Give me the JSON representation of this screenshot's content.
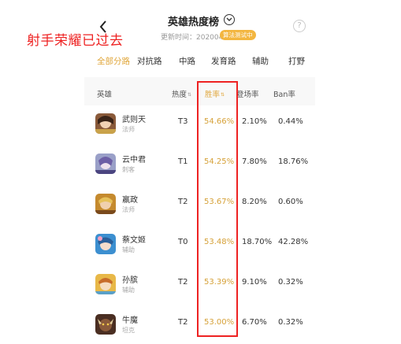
{
  "header": {
    "title": "英雄热度榜",
    "update_time": "更新时间：20200416",
    "badge": "算法测试中",
    "help_glyph": "?"
  },
  "annotation": {
    "overlay_text": "射手荣耀已过去",
    "color": "#ee2222"
  },
  "tabs": [
    {
      "label": "全部分路",
      "active": true
    },
    {
      "label": "对抗路",
      "active": false
    },
    {
      "label": "中路",
      "active": false
    },
    {
      "label": "发育路",
      "active": false
    },
    {
      "label": "辅助",
      "active": false
    },
    {
      "label": "打野",
      "active": false
    }
  ],
  "table": {
    "columns": [
      {
        "label": "英雄"
      },
      {
        "label": "热度",
        "sort_icon": "⇅"
      },
      {
        "label": "胜率",
        "sort_icon": "⇅"
      },
      {
        "label": "登场率"
      },
      {
        "label": "Ban率"
      }
    ],
    "rows": [
      {
        "name": "武则天",
        "role": "法师",
        "heat": "T3",
        "win": "54.66%",
        "appear": "2.10%",
        "ban": "0.44%"
      },
      {
        "name": "云中君",
        "role": "刺客",
        "heat": "T1",
        "win": "54.25%",
        "appear": "7.80%",
        "ban": "18.76%"
      },
      {
        "name": "嬴政",
        "role": "法师",
        "heat": "T2",
        "win": "53.67%",
        "appear": "8.20%",
        "ban": "0.60%"
      },
      {
        "name": "蔡文姬",
        "role": "辅助",
        "heat": "T0",
        "win": "53.48%",
        "appear": "18.70%",
        "ban": "42.28%"
      },
      {
        "name": "孙膑",
        "role": "辅助",
        "heat": "T2",
        "win": "53.39%",
        "appear": "9.10%",
        "ban": "0.32%"
      },
      {
        "name": "牛魔",
        "role": "坦克",
        "heat": "T2",
        "win": "53.00%",
        "appear": "6.70%",
        "ban": "0.32%"
      }
    ]
  },
  "colors": {
    "accent": "#e0a63a",
    "win_text": "#d6a138",
    "badge_bg": "#f3b640"
  }
}
